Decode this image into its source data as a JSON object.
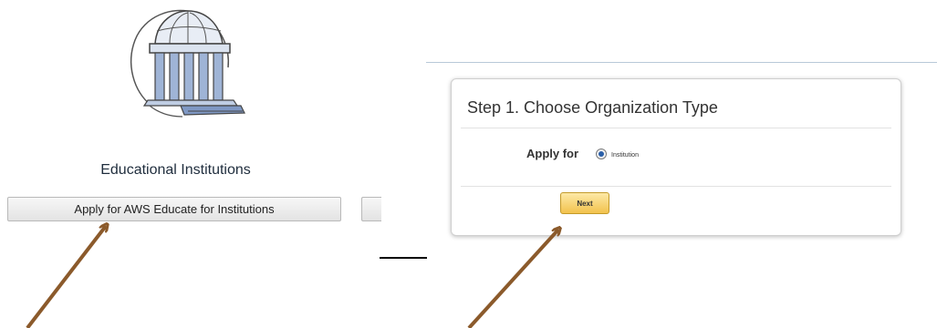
{
  "left_panel": {
    "logo_icon": "institution-building-icon",
    "title": "Educational Institutions",
    "apply_button_label": "Apply for AWS Educate for Institutions"
  },
  "step_panel": {
    "title": "Step 1. Choose Organization Type",
    "apply_for_label": "Apply for",
    "radio_option_label": "Institution",
    "radio_selected": true,
    "next_button_label": "Next"
  },
  "annotations": {
    "arrow_color": "#8B5A2B",
    "arrow_icon": "arrow-icon"
  },
  "colors": {
    "next_button": "#f2c24d",
    "radio_selected": "#2a5fa8",
    "divider_blue": "#b8c9d8"
  }
}
